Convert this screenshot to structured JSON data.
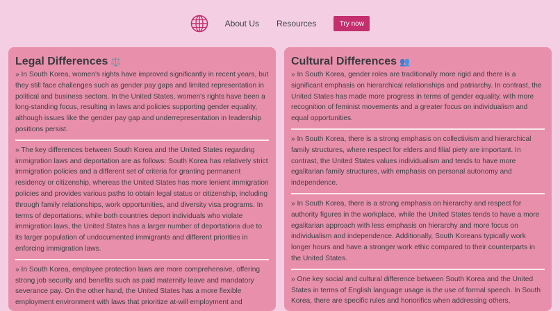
{
  "nav": {
    "links": [
      "About Us",
      "Resources"
    ],
    "cta": "Try now",
    "logo_icon": "globe-icon",
    "accent": "#c42f6e"
  },
  "legal": {
    "title": "Legal Differences",
    "title_emoji": "⚖️",
    "paragraphs": [
      "» In South Korea, women's rights have improved significantly in recent years, but they still face challenges such as gender pay gaps and limited representation in political and business sectors. In the United States, women's rights have been a long-standing focus, resulting in laws and policies supporting gender equality, although issues like the gender pay gap and underrepresentation in leadership positions persist.",
      "» The key differences between South Korea and the United States regarding immigration laws and deportation are as follows: South Korea has relatively strict immigration policies and a different set of criteria for granting permanent residency or citizenship, whereas the United States has more lenient immigration policies and provides various paths to obtain legal status or citizenship, including through family relationships, work opportunities, and diversity visa programs. In terms of deportations, while both countries deport individuals who violate immigration laws, the United States has a larger number of deportations due to its larger population of undocumented immigrants and different priorities in enforcing immigration laws.",
      "» In South Korea, employee protection laws are more comprehensive, offering strong job security and benefits such as paid maternity leave and mandatory severance pay. On the other hand, the United States has a more flexible employment environment with laws that prioritize at-will employment and"
    ]
  },
  "cultural": {
    "title": "Cultural Differences",
    "title_emoji": "👥",
    "paragraphs": [
      "» In South Korea, gender roles are traditionally more rigid and there is a significant emphasis on hierarchical relationships and patriarchy. In contrast, the United States has made more progress in terms of gender equality, with more recognition of feminist movements and a greater focus on individualism and equal opportunities.",
      "» In South Korea, there is a strong emphasis on collectivism and hierarchical family structures, where respect for elders and filial piety are important. In contrast, the United States values individualism and tends to have more egalitarian family structures, with emphasis on personal autonomy and independence.",
      "» In South Korea, there is a strong emphasis on hierarchy and respect for authority figures in the workplace, while the United States tends to have a more egalitarian approach with less emphasis on hierarchy and more focus on individualism and independence. Additionally, South Koreans typically work longer hours and have a stronger work ethic compared to their counterparts in the United States.",
      "» One key social and cultural difference between South Korea and the United States in terms of English language usage is the use of formal speech. In South Korea, there are specific rules and honorifics when addressing others,"
    ]
  }
}
